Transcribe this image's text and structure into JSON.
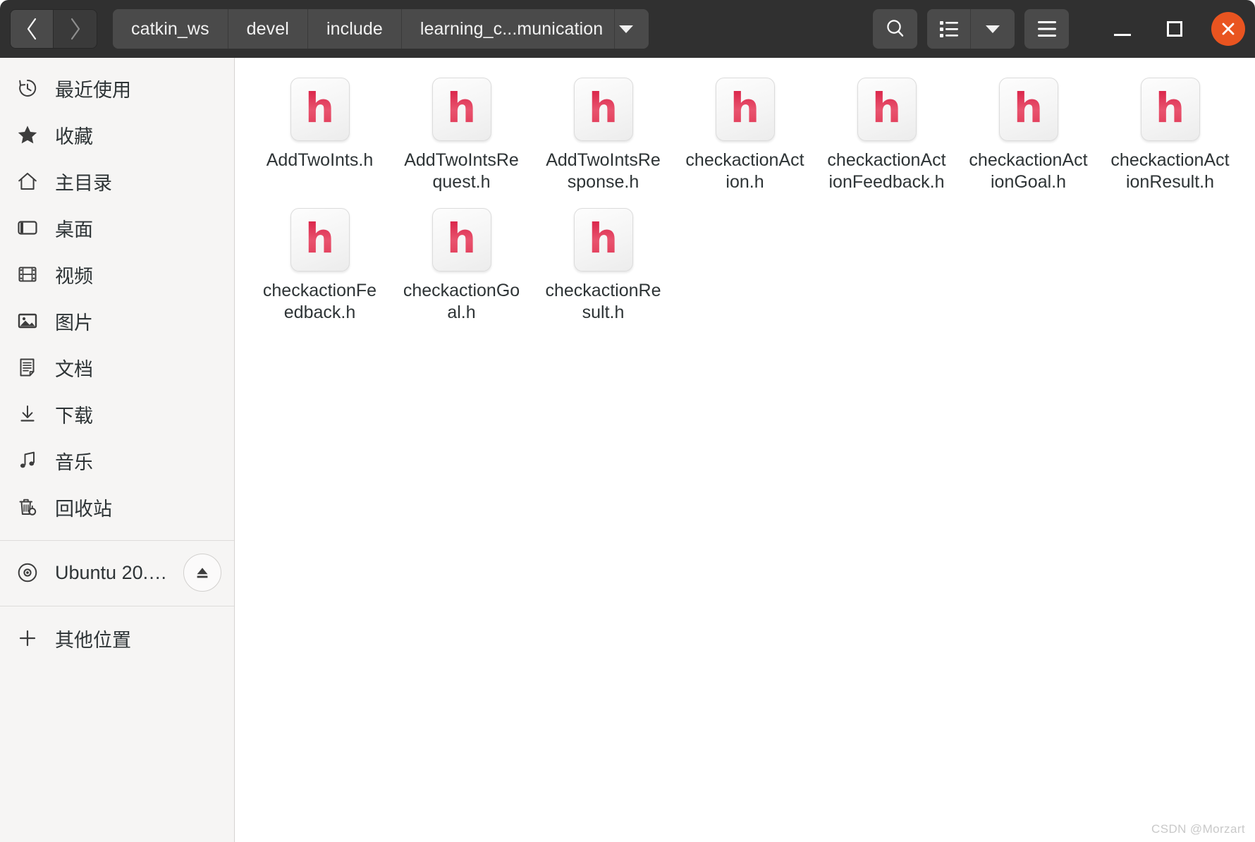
{
  "window": {
    "title": "learning_c...munication",
    "accent_color": "#e95420",
    "headerbar_color": "#303030",
    "sidebar_color": "#f6f5f4",
    "content_color": "#ffffff",
    "file_icon_color": "#e02a4c"
  },
  "header": {
    "back_label": "‹",
    "forward_label": "›",
    "breadcrumbs": [
      {
        "label": "catkin_ws"
      },
      {
        "label": "devel"
      },
      {
        "label": "include"
      },
      {
        "label": "learning_c...munication"
      }
    ],
    "path_dropdown_icon": "chevron-down-icon",
    "search_icon": "search-icon",
    "view_list_icon": "list-view-icon",
    "view_dropdown_icon": "chevron-down-icon",
    "menu_icon": "hamburger-menu-icon",
    "minimize_icon": "minimize-icon",
    "maximize_icon": "maximize-icon",
    "close_icon": "close-icon"
  },
  "sidebar": {
    "items": [
      {
        "label": "最近使用",
        "icon": "recent-clock-icon"
      },
      {
        "label": "收藏",
        "icon": "star-icon"
      },
      {
        "label": "主目录",
        "icon": "home-icon"
      },
      {
        "label": "桌面",
        "icon": "desktop-icon"
      },
      {
        "label": "视频",
        "icon": "video-film-icon"
      },
      {
        "label": "图片",
        "icon": "pictures-icon"
      },
      {
        "label": "文档",
        "icon": "documents-icon"
      },
      {
        "label": "下载",
        "icon": "downloads-icon"
      },
      {
        "label": "音乐",
        "icon": "music-note-icon"
      },
      {
        "label": "回收站",
        "icon": "trash-icon"
      }
    ],
    "devices": [
      {
        "label": "Ubuntu 20.0...",
        "icon": "disc-icon",
        "eject_icon": "eject-icon"
      }
    ],
    "other": [
      {
        "label": "其他位置",
        "icon": "plus-icon"
      }
    ]
  },
  "files": [
    {
      "name": "AddTwoInts.h",
      "icon": "header-file-icon",
      "letter": "h"
    },
    {
      "name": "AddTwoIntsRequest.h",
      "icon": "header-file-icon",
      "letter": "h"
    },
    {
      "name": "AddTwoIntsResponse.h",
      "icon": "header-file-icon",
      "letter": "h"
    },
    {
      "name": "checkactionAction.h",
      "icon": "header-file-icon",
      "letter": "h"
    },
    {
      "name": "checkactionActionFeedback.h",
      "icon": "header-file-icon",
      "letter": "h"
    },
    {
      "name": "checkactionActionGoal.h",
      "icon": "header-file-icon",
      "letter": "h"
    },
    {
      "name": "checkactionActionResult.h",
      "icon": "header-file-icon",
      "letter": "h"
    },
    {
      "name": "checkactionFeedback.h",
      "icon": "header-file-icon",
      "letter": "h"
    },
    {
      "name": "checkactionGoal.h",
      "icon": "header-file-icon",
      "letter": "h"
    },
    {
      "name": "checkactionResult.h",
      "icon": "header-file-icon",
      "letter": "h"
    }
  ],
  "watermark": "CSDN @Morzart"
}
